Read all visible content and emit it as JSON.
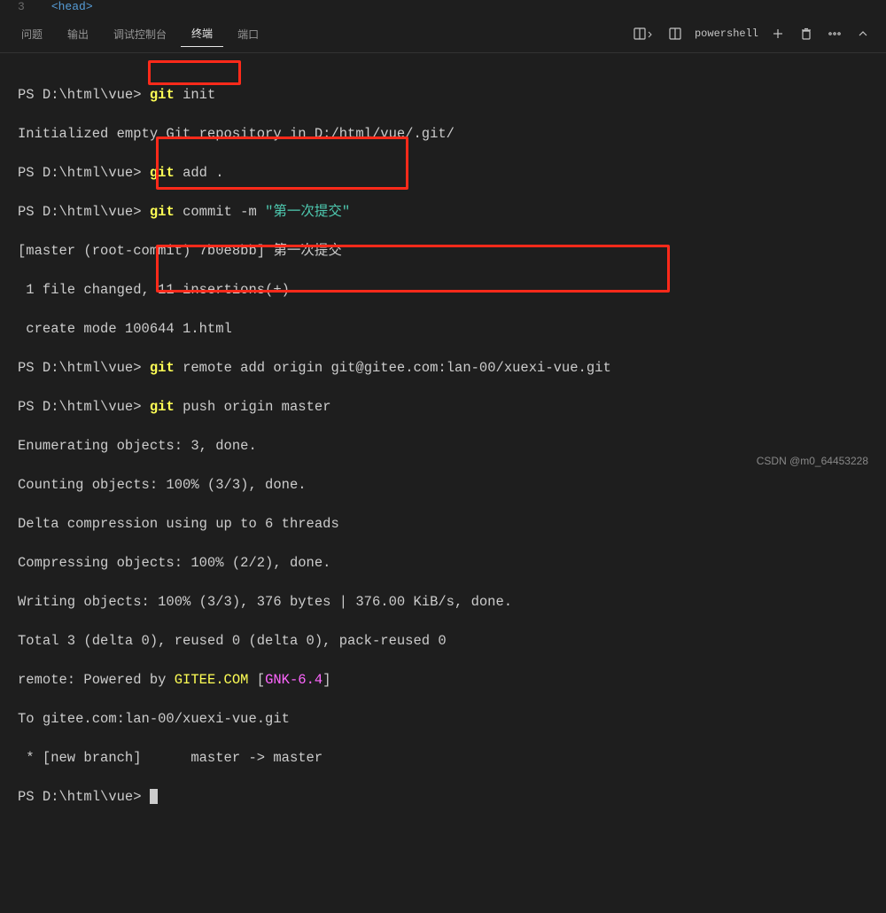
{
  "codePeek": {
    "lineNum": "3",
    "tagOpen": "<",
    "tagName": "head",
    "tagClose": ">"
  },
  "tabs": {
    "problems": "问题",
    "output": "输出",
    "debugConsole": "调试控制台",
    "terminal": "终端",
    "ports": "端口"
  },
  "toolbar": {
    "shellName": "powershell"
  },
  "terminal": {
    "prompt": "PS D:\\html\\vue>",
    "cmd_init": "init",
    "line_initrepo": "Initialized empty Git repository in D:/html/vue/.git/",
    "cmd_add": "add .",
    "cmd_commit_flags": "commit -m ",
    "cmd_commit_msg": "\"第一次提交\"",
    "line_commit_master": "[master (root-commit) 7b0e8bb] 第一次提交",
    "line_file_changed": " 1 file changed, 11 insertions(+)",
    "line_create_mode": " create mode 100644 1.html",
    "cmd_remote": "remote add origin git@gitee.com:lan-00/xuexi-vue.git",
    "cmd_push": "push origin master",
    "line_enum": "Enumerating objects: 3, done.",
    "line_count": "Counting objects: 100% (3/3), done.",
    "line_delta": "Delta compression using up to 6 threads",
    "line_compress": "Compressing objects: 100% (2/2), done.",
    "line_write": "Writing objects: 100% (3/3), 376 bytes | 376.00 KiB/s, done.",
    "line_total": "Total 3 (delta 0), reused 0 (delta 0), pack-reused 0",
    "line_remote_pre": "remote: Powered by ",
    "line_remote_gitee": "GITEE.COM",
    "line_remote_br1": " [",
    "line_remote_gnk": "GNK-6.4",
    "line_remote_br2": "]",
    "line_to": "To gitee.com:lan-00/xuexi-vue.git",
    "line_newbranch": " * [new branch]      master -> master"
  },
  "watermark": "CSDN @m0_64453228",
  "git_word": "git"
}
